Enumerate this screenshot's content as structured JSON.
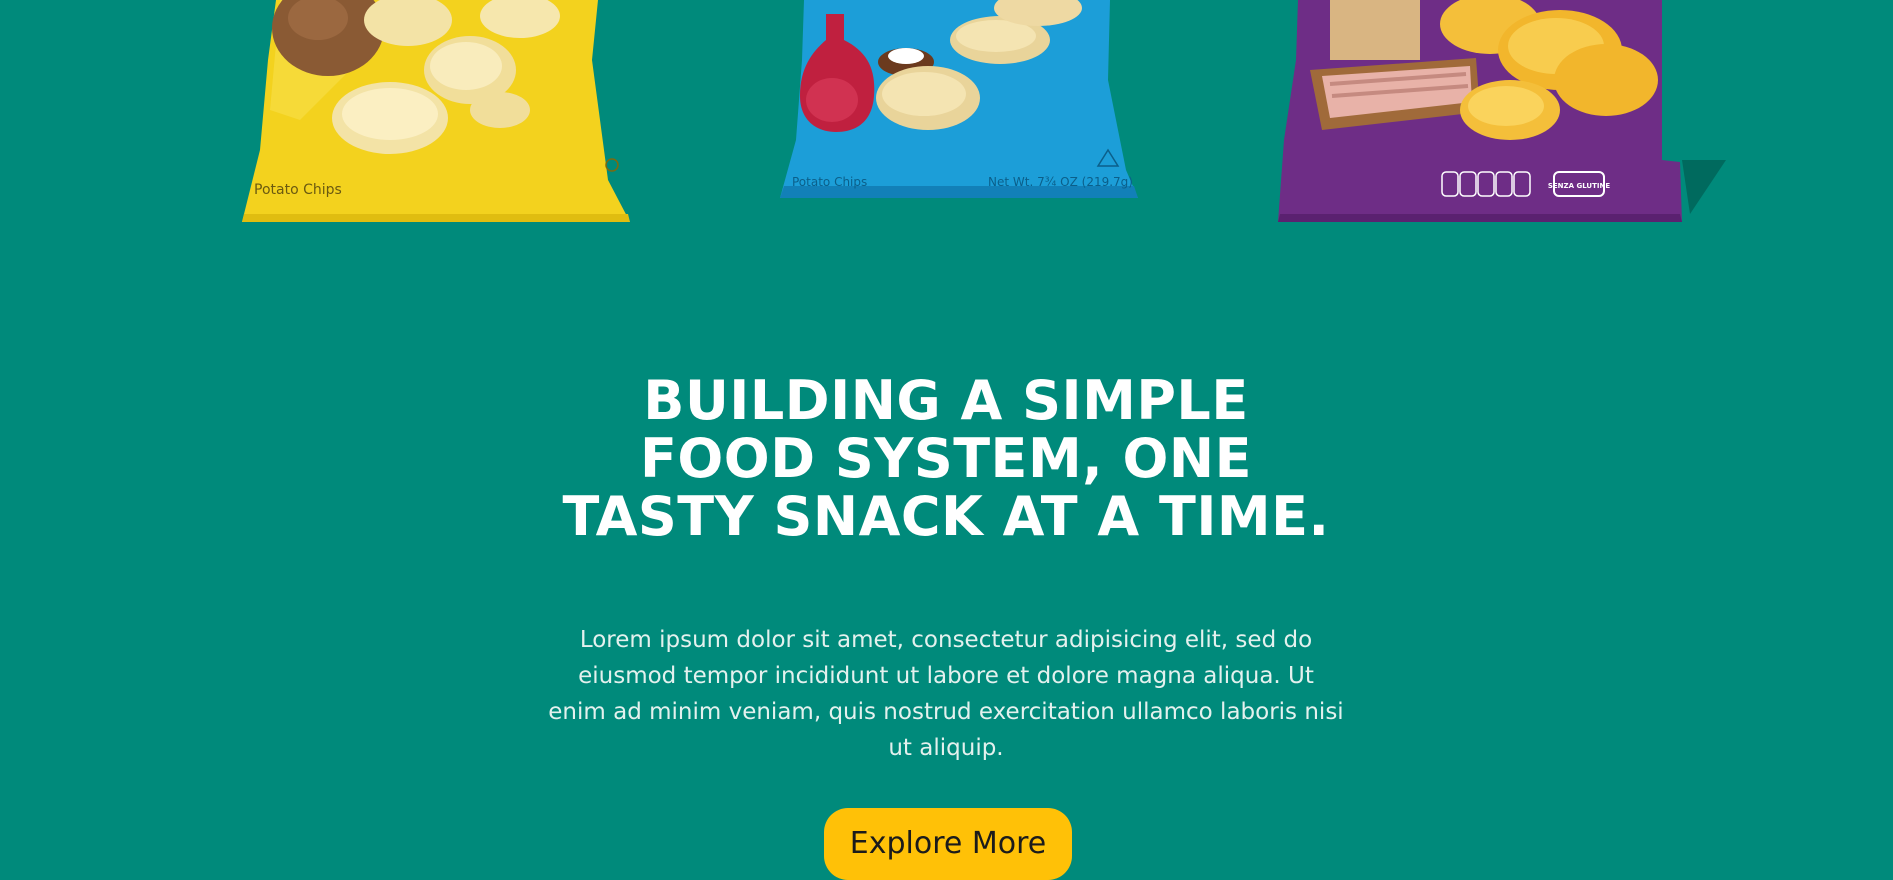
{
  "products": [
    {
      "name": "yellow-chip-bag",
      "color": "#f6d623",
      "label": "Potato Chips"
    },
    {
      "name": "blue-chip-bag",
      "color": "#1c9ed8",
      "label": "Potato Chips",
      "weight": "Net Wt. 7¾ OZ (219.7g)"
    },
    {
      "name": "purple-chip-bag",
      "color": "#6e2d86",
      "badge": "SENZA GLUTINE"
    }
  ],
  "hero": {
    "headline": "BUILDING A SIMPLE FOOD SYSTEM, ONE TASTY SNACK AT A TIME.",
    "body": "Lorem ipsum dolor sit amet, consectetur adipisicing elit, sed do eiusmod tempor incididunt ut labore et dolore magna aliqua. Ut enim ad minim veniam, quis nostrud exercitation ullamco laboris nisi ut aliquip.",
    "cta_label": "Explore More"
  },
  "colors": {
    "background": "#008a7b",
    "cta": "#ffc107",
    "headline": "#ffffff"
  }
}
